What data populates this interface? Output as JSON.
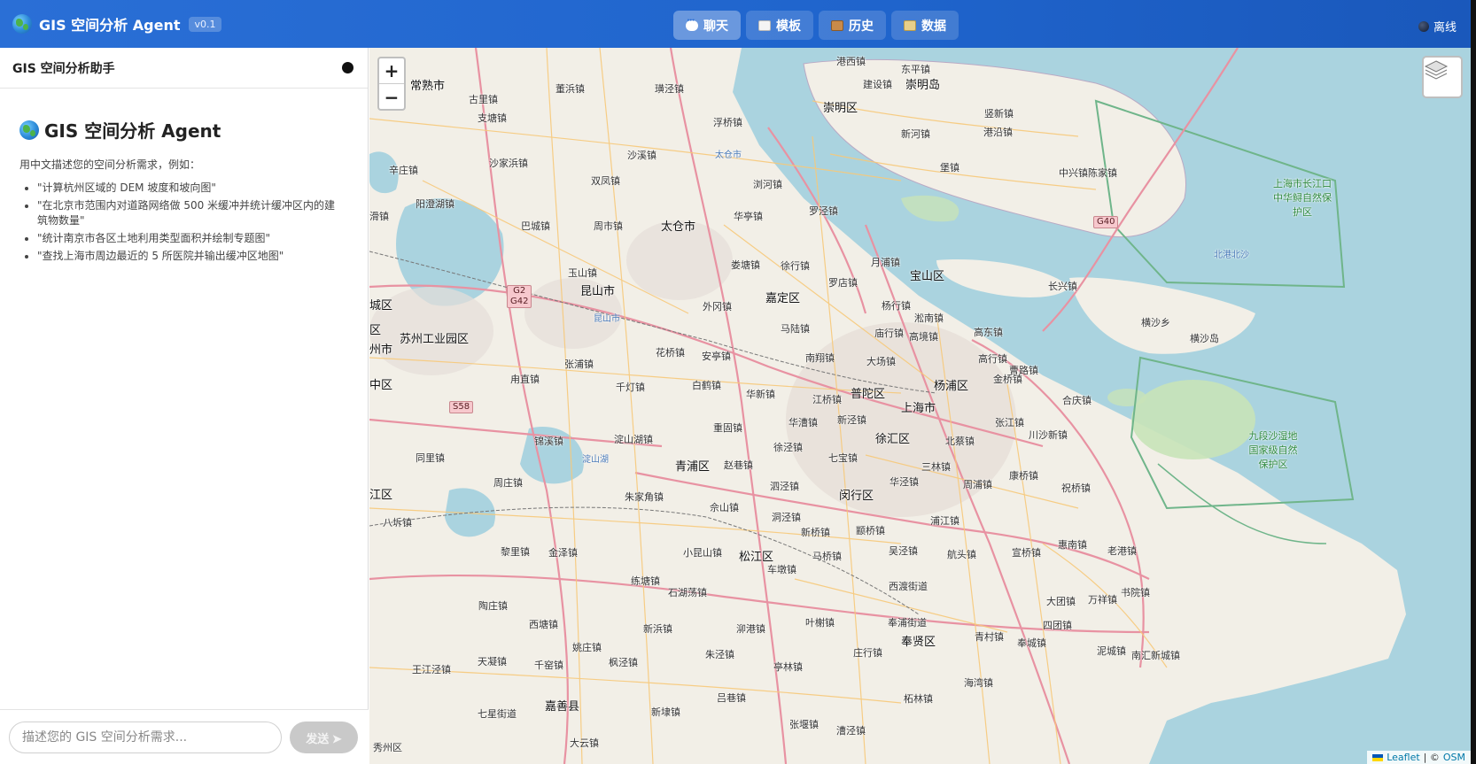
{
  "header": {
    "title": "GIS 空间分析 Agent",
    "version": "v0.1",
    "tabs": [
      {
        "label": "聊天",
        "icon": "chat-icon"
      },
      {
        "label": "模板",
        "icon": "clipboard-icon"
      },
      {
        "label": "历史",
        "icon": "archive-box-icon"
      },
      {
        "label": "数据",
        "icon": "folder-icon"
      }
    ],
    "status": "离线"
  },
  "panel": {
    "title": "GIS 空间分析助手",
    "welcome_title": "GIS 空间分析 Agent",
    "intro": "用中文描述您的空间分析需求，例如：",
    "examples": [
      "\"计算杭州区域的 DEM 坡度和坡向图\"",
      "\"在北京市范围内对道路网络做 500 米缓冲并统计缓冲区内的建筑物数量\"",
      "\"统计南京市各区土地利用类型面积并绘制专题图\"",
      "\"查找上海市周边最近的 5 所医院并输出缓冲区地图\""
    ],
    "input_placeholder": "描述您的 GIS 空间分析需求...",
    "send_label": "发送 ➤"
  },
  "map": {
    "zoom_in": "+",
    "zoom_out": "−",
    "attribution_leaflet": "Leaflet",
    "attribution_sep": "| ©",
    "attribution_osm": "OSM",
    "labels": {
      "l1": "常熟市",
      "l2": "古里镇",
      "l3": "董浜镇",
      "l4": "璜泾镇",
      "l5": "港西镇",
      "l6": "东平镇",
      "l7": "崇明岛",
      "l8": "崇明区",
      "l9": "建设镇",
      "l10": "竖新镇",
      "l11": "新河镇",
      "l12": "港沿镇",
      "l13": "堡镇",
      "l14": "中兴镇",
      "l15": "陈家镇",
      "l16": "支塘镇",
      "l17": "浮桥镇",
      "l18": "沙溪镇",
      "l19": "太仓市",
      "l20": "辛庄镇",
      "l21": "沙家浜镇",
      "l22": "双凤镇",
      "l23": "浏河镇",
      "l24": "阳澄湖镇",
      "l25": "华亭镇",
      "l26": "罗泾镇",
      "l27": "巴城镇",
      "l28": "周市镇",
      "l29": "月浦镇",
      "l30": "宝山区",
      "l31": "娄塘镇",
      "l32": "徐行镇",
      "l33": "长兴镇",
      "l34": "横沙乡",
      "l35": "横沙岛",
      "l36": "玉山镇",
      "l37": "罗店镇",
      "l38": "嘉定区",
      "l39": "昆山市",
      "l40": "杨行镇",
      "l41": "外冈镇",
      "l42": "淞南镇",
      "l43": "苏州工业园区",
      "l44": "马陆镇",
      "l45": "庙行镇",
      "l46": "高境镇",
      "l47": "高东镇",
      "l48": "花桥镇",
      "l49": "安亭镇",
      "l50": "南翔镇",
      "l51": "大场镇",
      "l52": "高行镇",
      "l53": "曹路镇",
      "l54": "张浦镇",
      "l55": "杨浦区",
      "l56": "金桥镇",
      "l57": "甪直镇",
      "l58": "千灯镇",
      "l59": "白鹤镇",
      "l60": "华新镇",
      "l61": "普陀区",
      "l62": "江桥镇",
      "l63": "上海市",
      "l64": "合庆镇",
      "l65": "新泾镇",
      "l66": "张江镇",
      "l67": "华漕镇",
      "l68": "重固镇",
      "l69": "锦溪镇",
      "l70": "淀山湖镇",
      "l71": "徐汇区",
      "l72": "北蔡镇",
      "l73": "川沙新镇",
      "l74": "徐泾镇",
      "l75": "同里镇",
      "l76": "青浦区",
      "l77": "赵巷镇",
      "l78": "七宝镇",
      "l79": "三林镇",
      "l80": "康桥镇",
      "l81": "周浦镇",
      "l82": "祝桥镇",
      "l83": "朱家角镇",
      "l84": "泗泾镇",
      "l85": "闵行区",
      "l86": "华泾镇",
      "l87": "佘山镇",
      "l88": "洞泾镇",
      "l89": "浦江镇",
      "l90": "周庄镇",
      "l91": "八坼镇",
      "l92": "新桥镇",
      "l93": "颛桥镇",
      "l94": "黎里镇",
      "l95": "金泽镇",
      "l96": "小昆山镇",
      "l97": "松江区",
      "l98": "马桥镇",
      "l99": "吴泾镇",
      "l100": "航头镇",
      "l101": "宣桥镇",
      "l102": "惠南镇",
      "l103": "老港镇",
      "l104": "练塘镇",
      "l105": "车墩镇",
      "l106": "石湖荡镇",
      "l107": "西渡街道",
      "l108": "大团镇",
      "l109": "万祥镇",
      "l110": "书院镇",
      "l111": "陶庄镇",
      "l112": "西塘镇",
      "l113": "新浜镇",
      "l114": "泖港镇",
      "l115": "叶榭镇",
      "l116": "奉浦街道",
      "l117": "四团镇",
      "l118": "姚庄镇",
      "l119": "青村镇",
      "l120": "奉贤区",
      "l121": "奉城镇",
      "l122": "泥城镇",
      "l123": "王江泾镇",
      "l124": "天凝镇",
      "l125": "千窑镇",
      "l126": "枫泾镇",
      "l127": "朱泾镇",
      "l128": "庄行镇",
      "l129": "亭林镇",
      "l130": "南汇新城镇",
      "l131": "海湾镇",
      "l132": "嘉善县",
      "l133": "七星街道",
      "l134": "吕巷镇",
      "l135": "柘林镇",
      "l136": "新埭镇",
      "l137": "张堰镇",
      "l138": "漕泾镇",
      "l139": "大云镇",
      "l140": "秀州区",
      "l141": "江区",
      "l142": "州市",
      "l143": "中区",
      "l144": "城区",
      "l145": "区",
      "l146": "滑镇"
    },
    "reserves": {
      "r1": "上海市长江口中华鲟自然保护区",
      "r2": "九段沙湿地国家级自然保护区",
      "r3": "北港北沙"
    },
    "water_labels": {
      "w1": "淀山湖",
      "w2": "太仓市",
      "w3": "昆山市"
    },
    "shields": {
      "s1": "G40",
      "s2": "G2\nG42",
      "s3": "S58"
    }
  }
}
